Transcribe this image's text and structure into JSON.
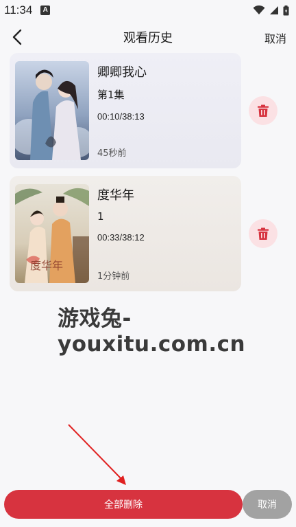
{
  "status_bar": {
    "time": "11:34",
    "notification_badge": "A"
  },
  "header": {
    "title": "观看历史",
    "cancel_label": "取消"
  },
  "history": [
    {
      "title": "卿卿我心",
      "episode": "第1集",
      "progress": "00:10/38:13",
      "watched_ago": "45秒前"
    },
    {
      "title": "度华年",
      "episode": "1",
      "progress": "00:33/38:12",
      "watched_ago": "1分钟前"
    }
  ],
  "watermark": "游戏兔-youxitu.com.cn",
  "bottom_bar": {
    "delete_all_label": "全部删除",
    "cancel_label": "取消"
  },
  "colors": {
    "accent_red": "#d7333f",
    "trash_bg": "#fbe1e4",
    "cancel_gray": "#a2a2a2"
  },
  "icons": [
    "back-arrow-icon",
    "trash-icon",
    "wifi-icon",
    "signal-icon",
    "battery-icon"
  ]
}
